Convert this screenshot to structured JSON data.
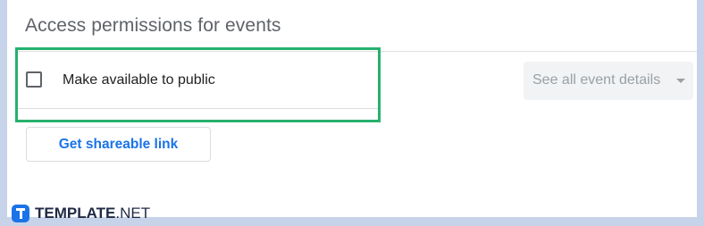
{
  "section": {
    "title": "Access permissions for events"
  },
  "public_option": {
    "label": "Make available to public",
    "checked": false
  },
  "details_select": {
    "selected": "See all event details"
  },
  "share_button": {
    "label": "Get shareable link"
  },
  "watermark": {
    "brand_bold": "TEMPLATE",
    "brand_suffix": ".NET"
  },
  "colors": {
    "highlight": "#27b06e",
    "accent": "#1a73e8"
  },
  "icons": {
    "checkbox": "checkbox-unchecked-icon",
    "dropdown": "caret-down-icon",
    "logo": "template-logo-icon"
  }
}
